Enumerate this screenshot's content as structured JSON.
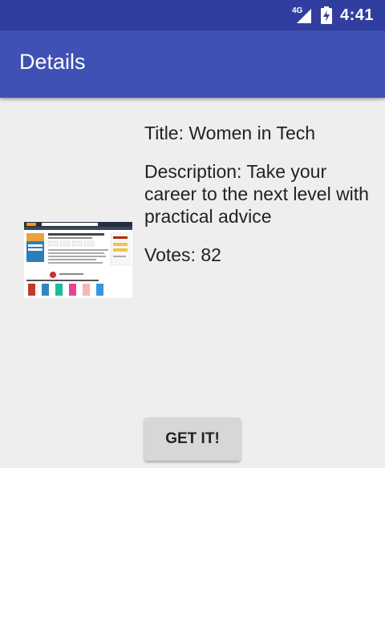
{
  "status_bar": {
    "network": "4G",
    "time": "4:41"
  },
  "app_bar": {
    "title": "Details"
  },
  "item": {
    "title_text": "Title: Women in Tech",
    "description_text": "Description: Take your career to the next level with practical advice",
    "votes_text": "Votes: 82",
    "thumbnail_icon": "product-page-screenshot-icon"
  },
  "actions": {
    "get_label": "GET IT!"
  },
  "colors": {
    "status_bar": "#303f9f",
    "app_bar": "#3f51b5",
    "content_bg": "#eeeeee",
    "button_bg": "#d6d7d7"
  }
}
